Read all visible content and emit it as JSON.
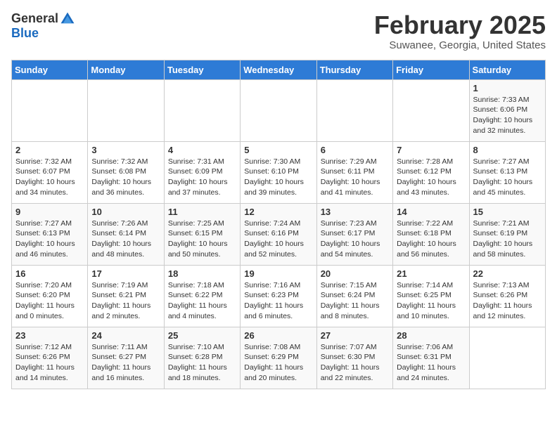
{
  "header": {
    "logo_general": "General",
    "logo_blue": "Blue",
    "month_title": "February 2025",
    "location": "Suwanee, Georgia, United States"
  },
  "days_of_week": [
    "Sunday",
    "Monday",
    "Tuesday",
    "Wednesday",
    "Thursday",
    "Friday",
    "Saturday"
  ],
  "weeks": [
    [
      {
        "day": "",
        "info": ""
      },
      {
        "day": "",
        "info": ""
      },
      {
        "day": "",
        "info": ""
      },
      {
        "day": "",
        "info": ""
      },
      {
        "day": "",
        "info": ""
      },
      {
        "day": "",
        "info": ""
      },
      {
        "day": "1",
        "info": "Sunrise: 7:33 AM\nSunset: 6:06 PM\nDaylight: 10 hours and 32 minutes."
      }
    ],
    [
      {
        "day": "2",
        "info": "Sunrise: 7:32 AM\nSunset: 6:07 PM\nDaylight: 10 hours and 34 minutes."
      },
      {
        "day": "3",
        "info": "Sunrise: 7:32 AM\nSunset: 6:08 PM\nDaylight: 10 hours and 36 minutes."
      },
      {
        "day": "4",
        "info": "Sunrise: 7:31 AM\nSunset: 6:09 PM\nDaylight: 10 hours and 37 minutes."
      },
      {
        "day": "5",
        "info": "Sunrise: 7:30 AM\nSunset: 6:10 PM\nDaylight: 10 hours and 39 minutes."
      },
      {
        "day": "6",
        "info": "Sunrise: 7:29 AM\nSunset: 6:11 PM\nDaylight: 10 hours and 41 minutes."
      },
      {
        "day": "7",
        "info": "Sunrise: 7:28 AM\nSunset: 6:12 PM\nDaylight: 10 hours and 43 minutes."
      },
      {
        "day": "8",
        "info": "Sunrise: 7:27 AM\nSunset: 6:13 PM\nDaylight: 10 hours and 45 minutes."
      }
    ],
    [
      {
        "day": "9",
        "info": "Sunrise: 7:27 AM\nSunset: 6:13 PM\nDaylight: 10 hours and 46 minutes."
      },
      {
        "day": "10",
        "info": "Sunrise: 7:26 AM\nSunset: 6:14 PM\nDaylight: 10 hours and 48 minutes."
      },
      {
        "day": "11",
        "info": "Sunrise: 7:25 AM\nSunset: 6:15 PM\nDaylight: 10 hours and 50 minutes."
      },
      {
        "day": "12",
        "info": "Sunrise: 7:24 AM\nSunset: 6:16 PM\nDaylight: 10 hours and 52 minutes."
      },
      {
        "day": "13",
        "info": "Sunrise: 7:23 AM\nSunset: 6:17 PM\nDaylight: 10 hours and 54 minutes."
      },
      {
        "day": "14",
        "info": "Sunrise: 7:22 AM\nSunset: 6:18 PM\nDaylight: 10 hours and 56 minutes."
      },
      {
        "day": "15",
        "info": "Sunrise: 7:21 AM\nSunset: 6:19 PM\nDaylight: 10 hours and 58 minutes."
      }
    ],
    [
      {
        "day": "16",
        "info": "Sunrise: 7:20 AM\nSunset: 6:20 PM\nDaylight: 11 hours and 0 minutes."
      },
      {
        "day": "17",
        "info": "Sunrise: 7:19 AM\nSunset: 6:21 PM\nDaylight: 11 hours and 2 minutes."
      },
      {
        "day": "18",
        "info": "Sunrise: 7:18 AM\nSunset: 6:22 PM\nDaylight: 11 hours and 4 minutes."
      },
      {
        "day": "19",
        "info": "Sunrise: 7:16 AM\nSunset: 6:23 PM\nDaylight: 11 hours and 6 minutes."
      },
      {
        "day": "20",
        "info": "Sunrise: 7:15 AM\nSunset: 6:24 PM\nDaylight: 11 hours and 8 minutes."
      },
      {
        "day": "21",
        "info": "Sunrise: 7:14 AM\nSunset: 6:25 PM\nDaylight: 11 hours and 10 minutes."
      },
      {
        "day": "22",
        "info": "Sunrise: 7:13 AM\nSunset: 6:26 PM\nDaylight: 11 hours and 12 minutes."
      }
    ],
    [
      {
        "day": "23",
        "info": "Sunrise: 7:12 AM\nSunset: 6:26 PM\nDaylight: 11 hours and 14 minutes."
      },
      {
        "day": "24",
        "info": "Sunrise: 7:11 AM\nSunset: 6:27 PM\nDaylight: 11 hours and 16 minutes."
      },
      {
        "day": "25",
        "info": "Sunrise: 7:10 AM\nSunset: 6:28 PM\nDaylight: 11 hours and 18 minutes."
      },
      {
        "day": "26",
        "info": "Sunrise: 7:08 AM\nSunset: 6:29 PM\nDaylight: 11 hours and 20 minutes."
      },
      {
        "day": "27",
        "info": "Sunrise: 7:07 AM\nSunset: 6:30 PM\nDaylight: 11 hours and 22 minutes."
      },
      {
        "day": "28",
        "info": "Sunrise: 7:06 AM\nSunset: 6:31 PM\nDaylight: 11 hours and 24 minutes."
      },
      {
        "day": "",
        "info": ""
      }
    ]
  ]
}
